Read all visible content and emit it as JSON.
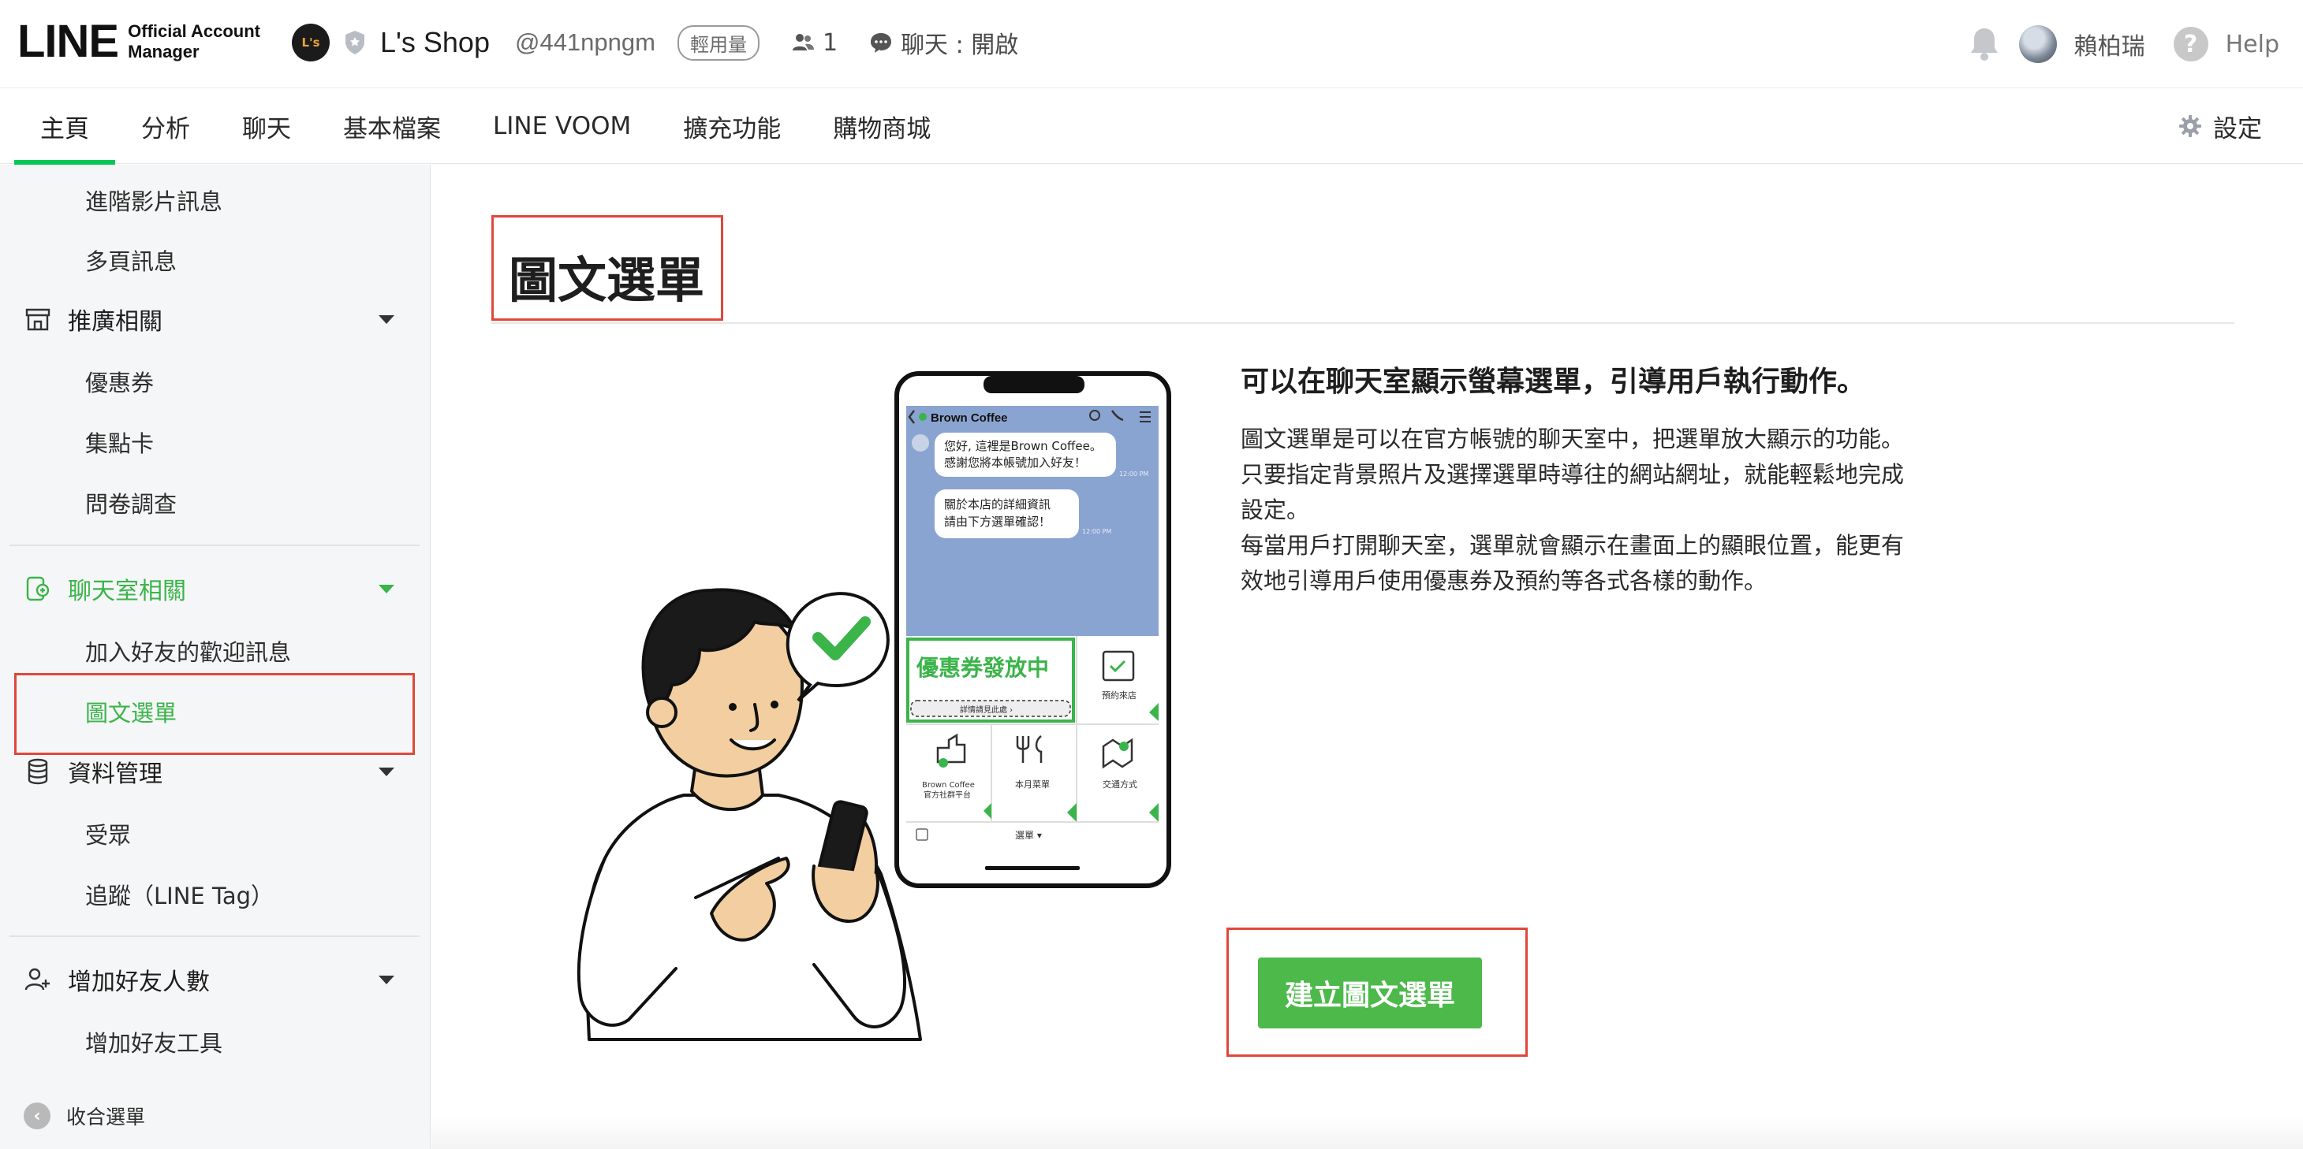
{
  "header": {
    "logo_main": "LINE",
    "logo_sub_line1": "Official Account",
    "logo_sub_line2": "Manager",
    "account_avatar_text": "L's",
    "account_name": "L's Shop",
    "account_id": "@441npngm",
    "plan_badge": "輕用量",
    "member_count": "1",
    "chat_status": "聊天 : 開啟",
    "user_name": "賴柏瑞",
    "help_label": "Help"
  },
  "nav": {
    "tabs": [
      {
        "label": "主頁",
        "active": true
      },
      {
        "label": "分析",
        "active": false
      },
      {
        "label": "聊天",
        "active": false
      },
      {
        "label": "基本檔案",
        "active": false
      },
      {
        "label": "LINE VOOM",
        "active": false
      },
      {
        "label": "擴充功能",
        "active": false
      },
      {
        "label": "購物商城",
        "active": false
      }
    ],
    "settings_label": "設定"
  },
  "sidebar": {
    "items": [
      {
        "label": "進階影片訊息"
      },
      {
        "label": "多頁訊息"
      },
      {
        "label": "推廣相關"
      },
      {
        "label": "優惠券"
      },
      {
        "label": "集點卡"
      },
      {
        "label": "問卷調查"
      },
      {
        "label": "聊天室相關"
      },
      {
        "label": "加入好友的歡迎訊息"
      },
      {
        "label": "圖文選單"
      },
      {
        "label": "資料管理"
      },
      {
        "label": "受眾"
      },
      {
        "label": "追蹤（LINE Tag）"
      },
      {
        "label": "增加好友人數"
      },
      {
        "label": "增加好友工具"
      }
    ],
    "collapse_label": "收合選單"
  },
  "main": {
    "page_title": "圖文選單",
    "heading": "可以在聊天室顯示螢幕選單，引導用戶執行動作。",
    "desc_lines": [
      "圖文選單是可以在官方帳號的聊天室中，把選單放大顯示的功能。",
      "只要指定背景照片及選擇選單時導往的網站網址，就能輕鬆地完成",
      "設定。",
      "每當用戶打開聊天室，選單就會顯示在畫面上的顯眼位置，能更有",
      "效地引導用戶使用優惠券及預約等各式各樣的動作。"
    ],
    "create_button": "建立圖文選單"
  },
  "phone": {
    "chat_name": "Brown Coffee",
    "bubble1_line1": "您好, 這裡是Brown Coffee。",
    "bubble1_line2": "感謝您將本帳號加入好友！",
    "bubble2_line1": "關於本店的詳細資訊",
    "bubble2_line2": "請由下方選單確認！",
    "time1": "12:00 PM",
    "time2": "12:00 PM",
    "coupon_banner": "優惠券發放中",
    "coupon_sub": "詳情請見此處 ›",
    "tile_reserve": "預約來店",
    "tile_social_line1": "Brown Coffee",
    "tile_social_line2": "官方社群平台",
    "tile_menu": "本月菜單",
    "tile_access": "交通方式",
    "menu_toggle": "選單 ▾"
  },
  "colors": {
    "line_green": "#06c755",
    "sidebar_active": "#3bb44a",
    "button_green": "#4cb94a",
    "highlight_red": "#e0473a"
  }
}
